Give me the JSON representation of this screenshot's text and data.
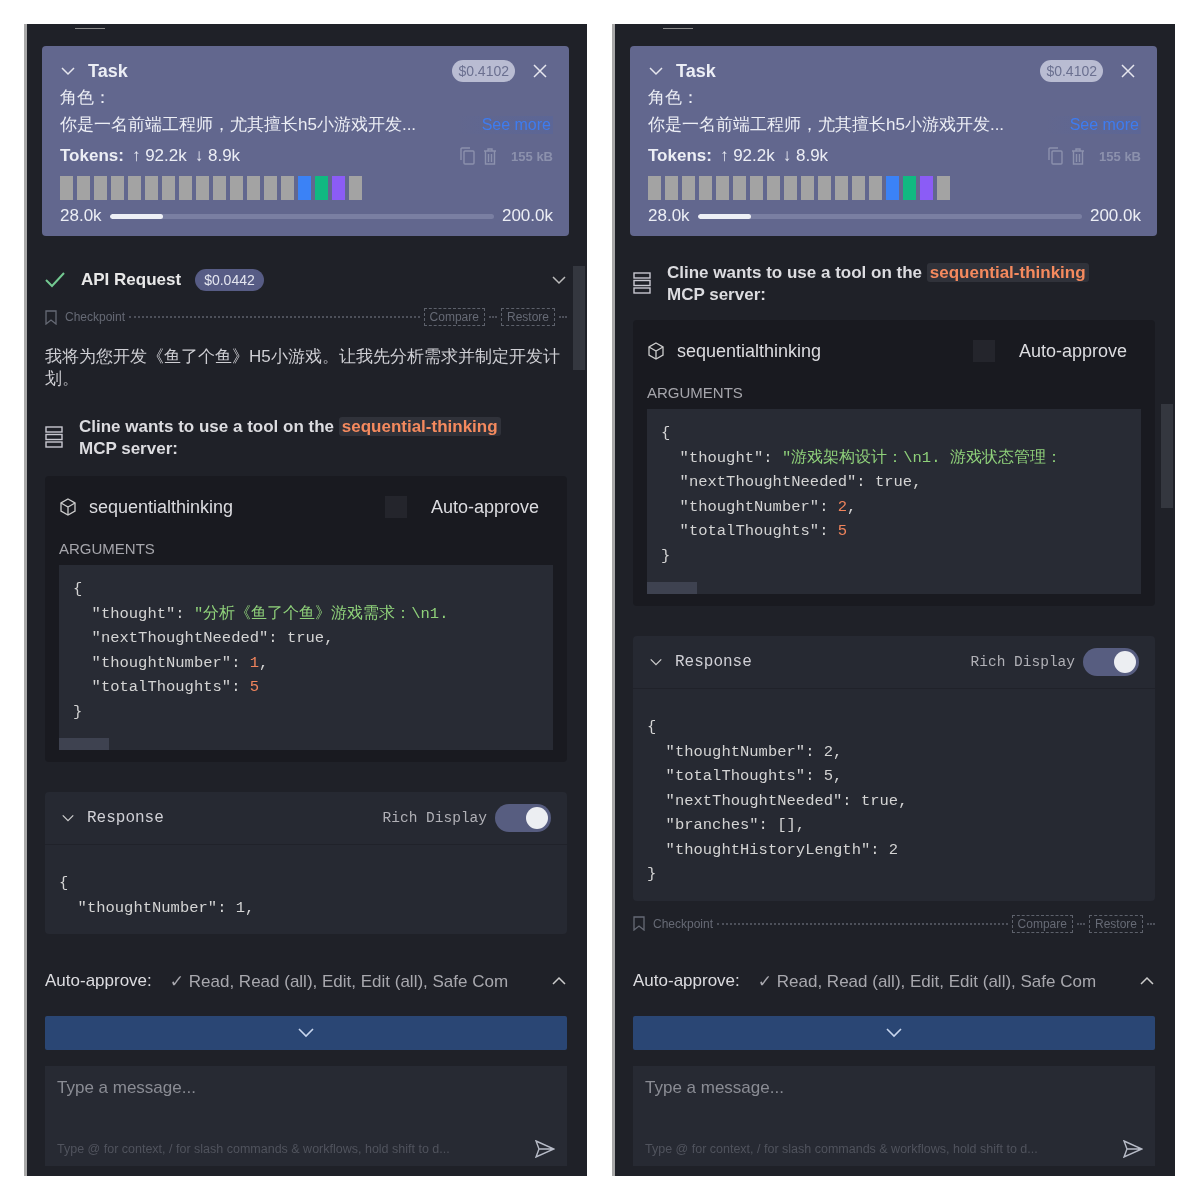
{
  "panels": [
    {
      "task": {
        "title": "Task",
        "cost": "$0.4102",
        "lines": [
          "角色：",
          "你是一名前端工程师，尤其擅长h5小游戏开发..."
        ],
        "see_more": "See more",
        "tokens_label": "Tokens:",
        "tokens_up": "↑ 92.2k",
        "tokens_down": "↓ 8.9k",
        "size": "155 kB",
        "blocks": [
          {
            "color": "#a3a3a3"
          },
          {
            "color": "#a3a3a3"
          },
          {
            "color": "#a3a3a3"
          },
          {
            "color": "#a3a3a3"
          },
          {
            "color": "#a3a3a3"
          },
          {
            "color": "#a3a3a3"
          },
          {
            "color": "#a3a3a3"
          },
          {
            "color": "#a3a3a3"
          },
          {
            "color": "#a3a3a3"
          },
          {
            "color": "#a3a3a3"
          },
          {
            "color": "#a3a3a3"
          },
          {
            "color": "#a3a3a3"
          },
          {
            "color": "#a3a3a3"
          },
          {
            "color": "#a3a3a3"
          },
          {
            "color": "#3b82f6"
          },
          {
            "color": "#10b981"
          },
          {
            "color": "#8b5cf6"
          },
          {
            "color": "#a3a3a3"
          }
        ],
        "context_used": "28.0k",
        "context_max": "200.0k",
        "level": 0.14
      },
      "messages": [
        {
          "kind": "api_request",
          "title": "API Request",
          "cost": "$0.0442",
          "done": true
        },
        {
          "kind": "checkpoint",
          "label": "Checkpoint",
          "actions": [
            "Compare",
            "Restore"
          ]
        },
        {
          "kind": "text",
          "text": "我将为您开发《鱼了个鱼》H5小游戏。让我先分析需求并制定开发计划。"
        },
        {
          "kind": "mcp_tool",
          "intro": "Cline wants to use a tool on the",
          "server": "sequential-thinking",
          "intro_end": "MCP server:",
          "tool": "sequentialthinking",
          "auto_approve": {
            "label": "Auto-approve",
            "checked": false
          },
          "arguments_label": "ARGUMENTS",
          "code": [
            [
              {
                "text": "{",
                "kind": "plain"
              }
            ],
            [
              {
                "text": "  \"thought\": ",
                "kind": "plain"
              },
              {
                "text": "\"分析《鱼了个鱼》游戏需求：\\n1. ",
                "kind": "string"
              }
            ],
            [
              {
                "text": "  \"nextThoughtNeeded\": true,",
                "kind": "plain"
              }
            ],
            [
              {
                "text": "  \"thoughtNumber\": ",
                "kind": "plain"
              },
              {
                "text": "1",
                "kind": "number"
              },
              {
                "text": ",",
                "kind": "plain"
              }
            ],
            [
              {
                "text": "  \"totalThoughts\": ",
                "kind": "plain"
              },
              {
                "text": "5",
                "kind": "number"
              }
            ],
            [
              {
                "text": "}",
                "kind": "plain"
              }
            ]
          ]
        },
        {
          "kind": "response",
          "title": "Response",
          "toggle": {
            "label": "Rich Display",
            "on": true
          },
          "lines": [
            "{",
            "  \"thoughtNumber\": 1,"
          ]
        }
      ],
      "auto_approve": {
        "label": "Auto-approve:",
        "summary": "✓ Read, Read (all), Edit, Edit (all), Safe Com"
      },
      "input": {
        "placeholder": "Type a message...",
        "hint": "Type @ for context, / for slash commands & workflows, hold shift to d..."
      }
    },
    {
      "task": {
        "title": "Task",
        "cost": "$0.4102",
        "lines": [
          "角色：",
          "你是一名前端工程师，尤其擅长h5小游戏开发..."
        ],
        "see_more": "See more",
        "tokens_label": "Tokens:",
        "tokens_up": "↑ 92.2k",
        "tokens_down": "↓ 8.9k",
        "size": "155 kB",
        "blocks": [
          {
            "color": "#a3a3a3"
          },
          {
            "color": "#a3a3a3"
          },
          {
            "color": "#a3a3a3"
          },
          {
            "color": "#a3a3a3"
          },
          {
            "color": "#a3a3a3"
          },
          {
            "color": "#a3a3a3"
          },
          {
            "color": "#a3a3a3"
          },
          {
            "color": "#a3a3a3"
          },
          {
            "color": "#a3a3a3"
          },
          {
            "color": "#a3a3a3"
          },
          {
            "color": "#a3a3a3"
          },
          {
            "color": "#a3a3a3"
          },
          {
            "color": "#a3a3a3"
          },
          {
            "color": "#a3a3a3"
          },
          {
            "color": "#3b82f6"
          },
          {
            "color": "#10b981"
          },
          {
            "color": "#8b5cf6"
          },
          {
            "color": "#a3a3a3"
          }
        ],
        "context_used": "28.0k",
        "context_max": "200.0k",
        "level": 0.14
      },
      "messages": [
        {
          "kind": "mcp_tool",
          "intro": "Cline wants to use a tool on the",
          "server": "sequential-thinking",
          "intro_end": "MCP server:",
          "tool": "sequentialthinking",
          "auto_approve": {
            "label": "Auto-approve",
            "checked": false
          },
          "arguments_label": "ARGUMENTS",
          "code": [
            [
              {
                "text": "{",
                "kind": "plain"
              }
            ],
            [
              {
                "text": "  \"thought\": ",
                "kind": "plain"
              },
              {
                "text": "\"游戏架构设计：\\n1. 游戏状态管理：",
                "kind": "string"
              }
            ],
            [
              {
                "text": "  \"nextThoughtNeeded\": true,",
                "kind": "plain"
              }
            ],
            [
              {
                "text": "  \"thoughtNumber\": ",
                "kind": "plain"
              },
              {
                "text": "2",
                "kind": "number"
              },
              {
                "text": ",",
                "kind": "plain"
              }
            ],
            [
              {
                "text": "  \"totalThoughts\": ",
                "kind": "plain"
              },
              {
                "text": "5",
                "kind": "number"
              }
            ],
            [
              {
                "text": "}",
                "kind": "plain"
              }
            ]
          ]
        },
        {
          "kind": "response",
          "title": "Response",
          "toggle": {
            "label": "Rich Display",
            "on": true
          },
          "lines": [
            "{",
            "  \"thoughtNumber\": 2,",
            "  \"totalThoughts\": 5,",
            "  \"nextThoughtNeeded\": true,",
            "  \"branches\": [],",
            "  \"thoughtHistoryLength\": 2",
            "}"
          ]
        },
        {
          "kind": "checkpoint",
          "label": "Checkpoint",
          "actions": [
            "Compare",
            "Restore"
          ]
        }
      ],
      "auto_approve": {
        "label": "Auto-approve:",
        "summary": "✓ Read, Read (all), Edit, Edit (all), Safe Com"
      },
      "input": {
        "placeholder": "Type a message...",
        "hint": "Type @ for context, / for slash commands & workflows, hold shift to d..."
      }
    }
  ]
}
